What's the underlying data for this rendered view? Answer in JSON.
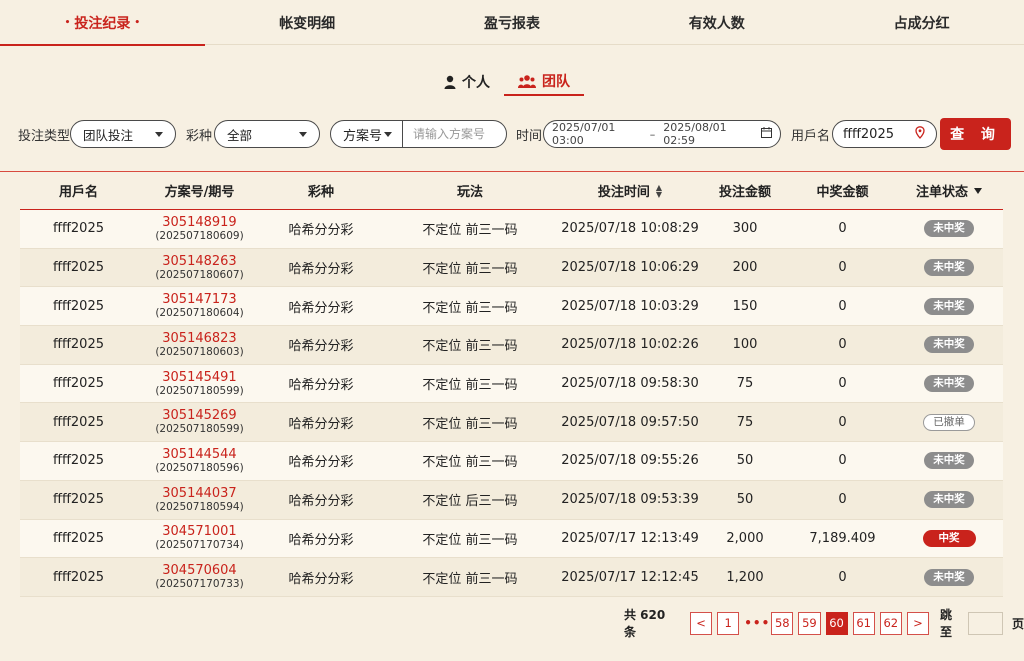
{
  "tabs": [
    "投注纪录",
    "帐变明细",
    "盈亏报表",
    "有效人数",
    "占成分红"
  ],
  "active_tab_dot": "•",
  "subtabs": {
    "personal": "个人",
    "team": "团队"
  },
  "filters": {
    "bet_type_label": "投注类型",
    "bet_type_value": "团队投注",
    "lottery_label": "彩种",
    "lottery_value": "全部",
    "plan_select": "方案号",
    "plan_placeholder": "请输入方案号",
    "time_label": "时间",
    "date_start": "2025/07/01 03:00",
    "date_sep": "–",
    "date_end": "2025/08/01 02:59",
    "user_label": "用戶名",
    "user_value": "ffff2025",
    "query_button": "查 询"
  },
  "columns": [
    "用戶名",
    "方案号/期号",
    "彩种",
    "玩法",
    "投注时间",
    "投注金额",
    "中奖金额",
    "注单状态"
  ],
  "rows": [
    {
      "user": "ffff2025",
      "plan": "305148919",
      "period": "(202507180609)",
      "lottery": "哈希分分彩",
      "play": "不定位 前三一码",
      "time": "2025/07/18 10:08:29",
      "bet": "300",
      "win": "0",
      "status": "未中奖",
      "kind": "none"
    },
    {
      "user": "ffff2025",
      "plan": "305148263",
      "period": "(202507180607)",
      "lottery": "哈希分分彩",
      "play": "不定位 前三一码",
      "time": "2025/07/18 10:06:29",
      "bet": "200",
      "win": "0",
      "status": "未中奖",
      "kind": "none"
    },
    {
      "user": "ffff2025",
      "plan": "305147173",
      "period": "(202507180604)",
      "lottery": "哈希分分彩",
      "play": "不定位 前三一码",
      "time": "2025/07/18 10:03:29",
      "bet": "150",
      "win": "0",
      "status": "未中奖",
      "kind": "none"
    },
    {
      "user": "ffff2025",
      "plan": "305146823",
      "period": "(202507180603)",
      "lottery": "哈希分分彩",
      "play": "不定位 前三一码",
      "time": "2025/07/18 10:02:26",
      "bet": "100",
      "win": "0",
      "status": "未中奖",
      "kind": "none"
    },
    {
      "user": "ffff2025",
      "plan": "305145491",
      "period": "(202507180599)",
      "lottery": "哈希分分彩",
      "play": "不定位 前三一码",
      "time": "2025/07/18 09:58:30",
      "bet": "75",
      "win": "0",
      "status": "未中奖",
      "kind": "none"
    },
    {
      "user": "ffff2025",
      "plan": "305145269",
      "period": "(202507180599)",
      "lottery": "哈希分分彩",
      "play": "不定位 前三一码",
      "time": "2025/07/18 09:57:50",
      "bet": "75",
      "win": "0",
      "status": "已撤单",
      "kind": "cancel"
    },
    {
      "user": "ffff2025",
      "plan": "305144544",
      "period": "(202507180596)",
      "lottery": "哈希分分彩",
      "play": "不定位 前三一码",
      "time": "2025/07/18 09:55:26",
      "bet": "50",
      "win": "0",
      "status": "未中奖",
      "kind": "none"
    },
    {
      "user": "ffff2025",
      "plan": "305144037",
      "period": "(202507180594)",
      "lottery": "哈希分分彩",
      "play": "不定位 后三一码",
      "time": "2025/07/18 09:53:39",
      "bet": "50",
      "win": "0",
      "status": "未中奖",
      "kind": "none"
    },
    {
      "user": "ffff2025",
      "plan": "304571001",
      "period": "(202507170734)",
      "lottery": "哈希分分彩",
      "play": "不定位 前三一码",
      "time": "2025/07/17 12:13:49",
      "bet": "2,000",
      "win": "7,189.409",
      "status": "中奖",
      "kind": "win"
    },
    {
      "user": "ffff2025",
      "plan": "304570604",
      "period": "(202507170733)",
      "lottery": "哈希分分彩",
      "play": "不定位 前三一码",
      "time": "2025/07/17 12:12:45",
      "bet": "1,200",
      "win": "0",
      "status": "未中奖",
      "kind": "none"
    }
  ],
  "pagination": {
    "total": "共 620 条",
    "prev": "<",
    "first": "1",
    "ellipsis": "•••",
    "pages": [
      "58",
      "59",
      "60",
      "61",
      "62"
    ],
    "current": "60",
    "next": ">",
    "jump_label": "跳至",
    "page_unit": "页"
  },
  "colors": {
    "accent": "#c9231c",
    "background": "#f7f0e2",
    "lost_badge": "#8d8d8d"
  }
}
